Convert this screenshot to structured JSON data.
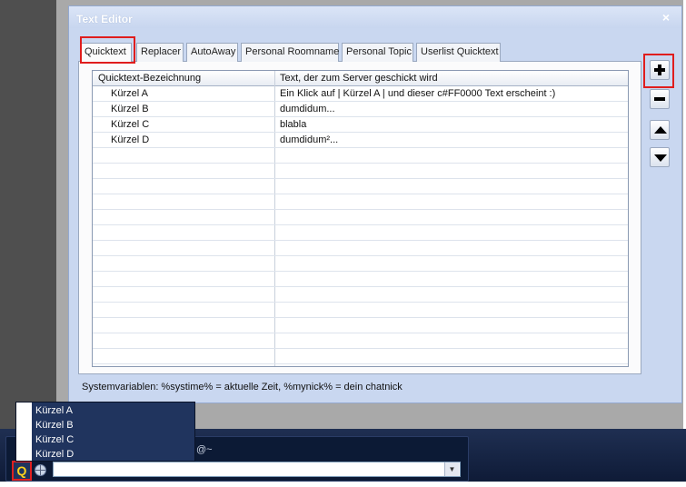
{
  "window": {
    "title": "Text Editor",
    "close_symbol": "×"
  },
  "tabs": [
    {
      "label": "Quicktext",
      "active": true
    },
    {
      "label": "Replacer",
      "active": false
    },
    {
      "label": "AutoAway",
      "active": false
    },
    {
      "label": "Personal Roomname",
      "active": false
    },
    {
      "label": "Personal Topic",
      "active": false
    },
    {
      "label": "Userlist Quicktext",
      "active": false
    }
  ],
  "table": {
    "columns": [
      "Quicktext-Bezeichnung",
      "Text, der zum Server geschickt wird"
    ],
    "rows": [
      {
        "name": "Kürzel A",
        "text": "Ein Klick auf | Kürzel A | und dieser c#FF0000 Text erscheint :)"
      },
      {
        "name": "Kürzel B",
        "text": "dumdidum..."
      },
      {
        "name": "Kürzel C",
        "text": "blabla"
      },
      {
        "name": "Kürzel D",
        "text": "dumdidum²..."
      }
    ]
  },
  "system_vars": "Systemvariablen: %systime% = aktuelle Zeit, %mynick% = dein chatnick",
  "side_buttons": {
    "add_icon": "plus-icon",
    "remove_icon": "minus-icon",
    "up_icon": "arrow-up-icon",
    "down_icon": "arrow-down-icon"
  },
  "popup": {
    "items": [
      "Kürzel A",
      "Kürzel B",
      "Kürzel C",
      "Kürzel D"
    ]
  },
  "chatbar": {
    "q_label": "Q",
    "label_fragment": "@~",
    "input_value": ""
  },
  "colors": {
    "highlight_red": "#e01d1d",
    "window_bg": "#c9d7f0",
    "popup_bg": "#20345e",
    "q_yellow": "#ffd31c"
  }
}
